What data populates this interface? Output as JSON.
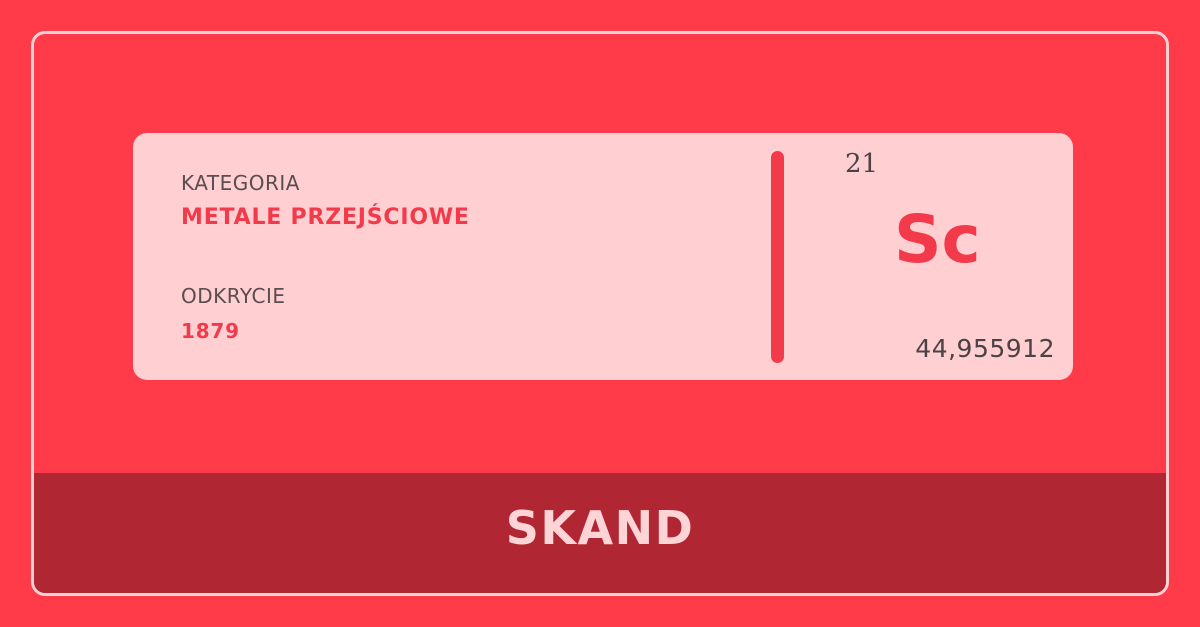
{
  "element": {
    "category_label": "KATEGORIA",
    "category_value": "METALE PRZEJŚCIOWE",
    "discovery_label": "ODKRYCIE",
    "discovery_value": "1879",
    "atomic_number": "21",
    "symbol": "Sc",
    "atomic_mass": "44,955912",
    "name": "SKAND"
  },
  "colors": {
    "background": "#ff3b4a",
    "card": "#ffcfd1",
    "accent": "#f23a4a",
    "footer": "#b02632",
    "footer_text": "#ffd4d6",
    "frame_border": "#ffd0d3"
  }
}
